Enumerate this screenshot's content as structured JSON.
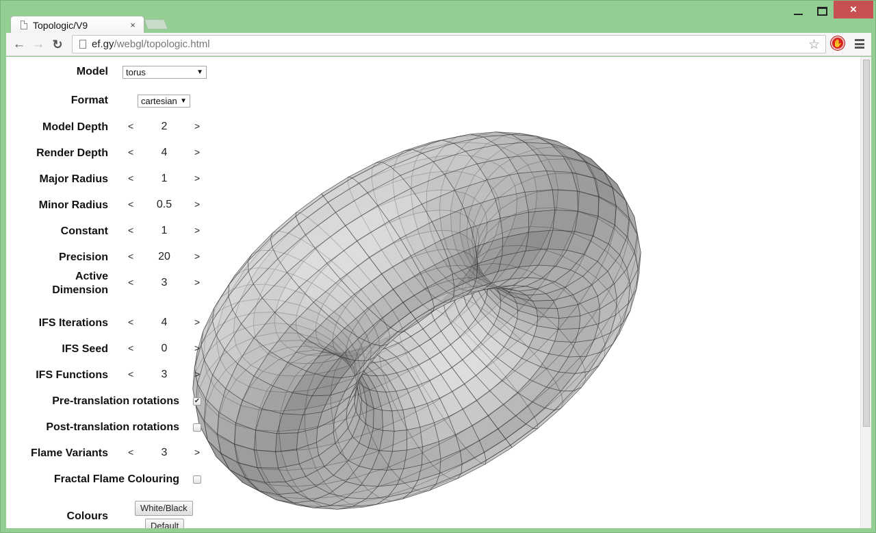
{
  "window": {
    "controls": {
      "minimize": "minimize-icon",
      "maximize": "maximize-icon",
      "close": "×"
    }
  },
  "tabs": [
    {
      "title": "Topologic/V9",
      "close": "×",
      "active": true
    }
  ],
  "toolbar": {
    "back": "←",
    "forward": "→",
    "reload": "↻",
    "url_host": "ef.gy",
    "url_path": "/webgl/topologic.html",
    "star": "☆",
    "extension": "✋"
  },
  "controls": {
    "model": {
      "label": "Model",
      "value": "torus"
    },
    "format": {
      "label": "Format",
      "value": "cartesian"
    },
    "steppers": [
      {
        "label": "Model Depth",
        "value": "2"
      },
      {
        "label": "Render Depth",
        "value": "4"
      },
      {
        "label": "Major Radius",
        "value": "1"
      },
      {
        "label": "Minor Radius",
        "value": "0.5"
      },
      {
        "label": "Constant",
        "value": "1"
      },
      {
        "label": "Precision",
        "value": "20"
      },
      {
        "label": "Active\nDimension",
        "label_line1": "Active",
        "label_line2": "Dimension",
        "value": "3"
      },
      {
        "label": "IFS Iterations",
        "value": "4"
      },
      {
        "label": "IFS Seed",
        "value": "0"
      },
      {
        "label": "IFS Functions",
        "value": "3"
      }
    ],
    "pre_translation": {
      "label": "Pre-translation rotations",
      "checked": true
    },
    "post_translation": {
      "label": "Post-translation rotations",
      "checked": false
    },
    "flame_variants": {
      "label": "Flame Variants",
      "value": "3"
    },
    "fractal_flame_colouring": {
      "label": "Fractal Flame Colouring",
      "checked": false
    },
    "colours": {
      "label": "Colours",
      "buttons": [
        "White/Black",
        "Default"
      ]
    },
    "decrement": "<",
    "increment": ">"
  }
}
